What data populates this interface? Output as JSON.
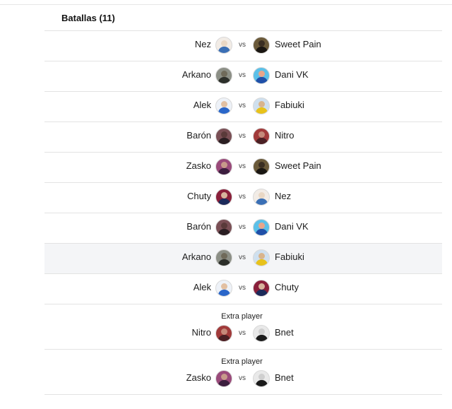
{
  "section": {
    "title": "Batallas (11)"
  },
  "vs_label": "vs",
  "extra_label": "Extra player",
  "battles": [
    {
      "left": "Nez",
      "right": "Sweet Pain",
      "extra": false
    },
    {
      "left": "Arkano",
      "right": "Dani VK",
      "extra": false
    },
    {
      "left": "Alek",
      "right": "Fabiuki",
      "extra": false
    },
    {
      "left": "Barón",
      "right": "Nitro",
      "extra": false
    },
    {
      "left": "Zasko",
      "right": "Sweet Pain",
      "extra": false
    },
    {
      "left": "Chuty",
      "right": "Nez",
      "extra": false
    },
    {
      "left": "Barón",
      "right": "Dani VK",
      "extra": false
    },
    {
      "left": "Arkano",
      "right": "Fabiuki",
      "extra": false,
      "highlighted": true
    },
    {
      "left": "Alek",
      "right": "Chuty",
      "extra": false
    },
    {
      "left": "Nitro",
      "right": "Bnet",
      "extra": true
    },
    {
      "left": "Zasko",
      "right": "Bnet",
      "extra": true
    }
  ],
  "avatar_colors": {
    "Nez": [
      "#e9d7c4",
      "#3a6fb5",
      "#f2ece6"
    ],
    "Sweet Pain": [
      "#3a2e22",
      "#1a1612",
      "#6b5a3a"
    ],
    "Arkano": [
      "#6f6a5a",
      "#2c2f2a",
      "#8c8f86"
    ],
    "Dani VK": [
      "#e8a58a",
      "#1f4fa8",
      "#5bc0e8"
    ],
    "Alek": [
      "#e2c0a2",
      "#2a66c9",
      "#eef2f8"
    ],
    "Fabiuki": [
      "#d9b48c",
      "#e8c21a",
      "#cfe0ef"
    ],
    "Barón": [
      "#5a3a3a",
      "#2a1e22",
      "#7a4f55"
    ],
    "Nitro": [
      "#c58a7a",
      "#4a2024",
      "#a13a3a"
    ],
    "Zasko": [
      "#c79a8a",
      "#3c1e3e",
      "#9a4a7a"
    ],
    "Chuty": [
      "#d7b39c",
      "#1b2a5a",
      "#8a1f3a"
    ],
    "Bnet": [
      "#cfcfcf",
      "#1a1a1a",
      "#e9e9e9"
    ]
  }
}
